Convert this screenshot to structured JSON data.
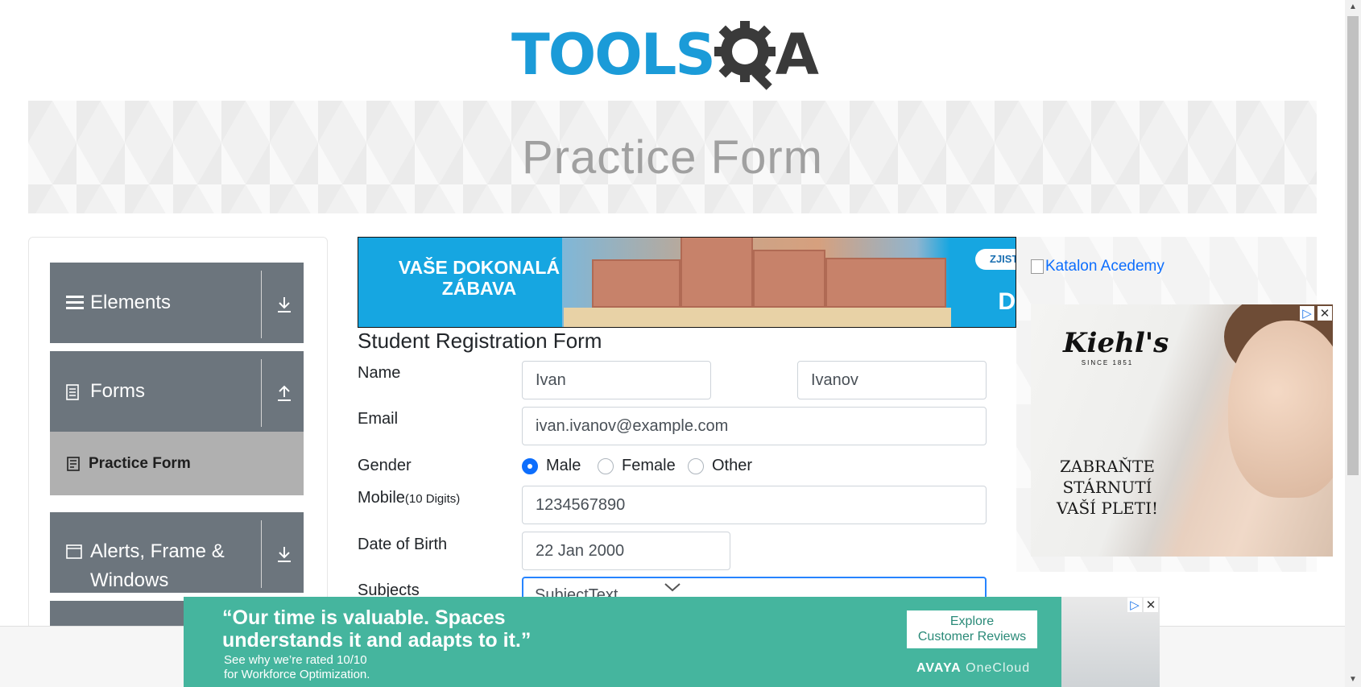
{
  "logo": {
    "text": "TOOLS",
    "suffix": "A"
  },
  "banner": {
    "title": "Practice Form"
  },
  "sidebar": {
    "groups": [
      {
        "label": "Elements",
        "icon": "hamburger-icon",
        "arrow": "download-arrow-icon"
      },
      {
        "label": "Forms",
        "icon": "document-icon",
        "arrow": "upload-arrow-icon"
      },
      {
        "label": "Alerts, Frame &",
        "label_line2": "Windows",
        "icon": "window-icon",
        "arrow": "download-arrow-icon"
      }
    ],
    "active_item": {
      "label": "Practice Form",
      "icon": "form-icon"
    }
  },
  "ad_top": {
    "headline_1": "VAŠE DOKONALÁ",
    "headline_2": "ZÁBAVA",
    "button": "ZJIST",
    "corner_letter": "D"
  },
  "form": {
    "title": "Student Registration Form",
    "name_label": "Name",
    "first_name": "Ivan",
    "last_name": "Ivanov",
    "email_label": "Email",
    "email": "ivan.ivanov@example.com",
    "gender_label": "Gender",
    "gender_options": [
      "Male",
      "Female",
      "Other"
    ],
    "gender_selected": "Male",
    "mobile_label": "Mobile",
    "mobile_hint": "(10 Digits)",
    "mobile": "1234567890",
    "dob_label": "Date of Birth",
    "dob": "22 Jan 2000",
    "subjects_label": "Subjects",
    "subjects_value": "SubjectText"
  },
  "ad_right": {
    "broken_image_alt": "Katalon Acedemy",
    "brand": "Kiehl's",
    "since": "SINCE 1851",
    "slogan_1": "ZABRAŇTE",
    "slogan_2": "STÁRNUTÍ",
    "slogan_3": "VAŠÍ PLETI!"
  },
  "ad_bottom": {
    "quote_1": "“Our time is valuable. Spaces",
    "quote_2": "understands it and adapts to it.”",
    "sub_1": "See why we’re rated 10/10",
    "sub_2": "for Workforce Optimization.",
    "cta_1": "Explore",
    "cta_2": "Customer Reviews",
    "brand": "AVAYA",
    "brand_suffix": " OneCloud"
  },
  "colors": {
    "logo_blue": "#1b9bd8",
    "sidebar_group": "#6c757d",
    "active_item": "#b0b0b0",
    "focus_border": "#2684ff",
    "radio_checked": "#0d6efd",
    "ad_bottom": "#45b59e"
  }
}
